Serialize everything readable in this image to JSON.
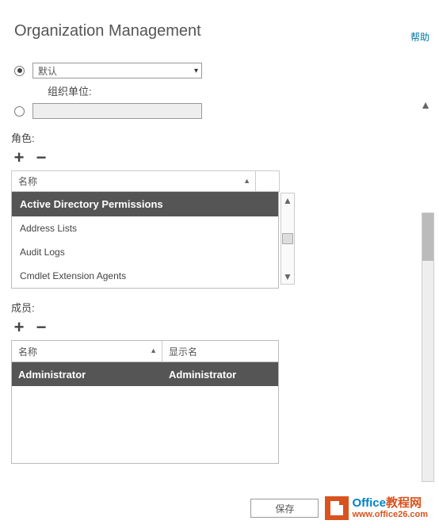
{
  "header": {
    "help": "帮助",
    "title": "Organization Management"
  },
  "scope": {
    "dropdown_value": "默认",
    "ou_label": "组织单位:"
  },
  "roles": {
    "label": "角色:",
    "header": "名称",
    "items": [
      "Active Directory Permissions",
      "Address Lists",
      "Audit Logs",
      "Cmdlet Extension Agents"
    ],
    "selected_index": 0
  },
  "members": {
    "label": "成员:",
    "headers": [
      "名称",
      "显示名"
    ],
    "rows": [
      {
        "name": "Administrator",
        "display": "Administrator"
      }
    ]
  },
  "actions": {
    "save": "保存"
  },
  "watermark": {
    "brand_a": "Office",
    "brand_b": "教程网",
    "url": "www.office26.com"
  }
}
